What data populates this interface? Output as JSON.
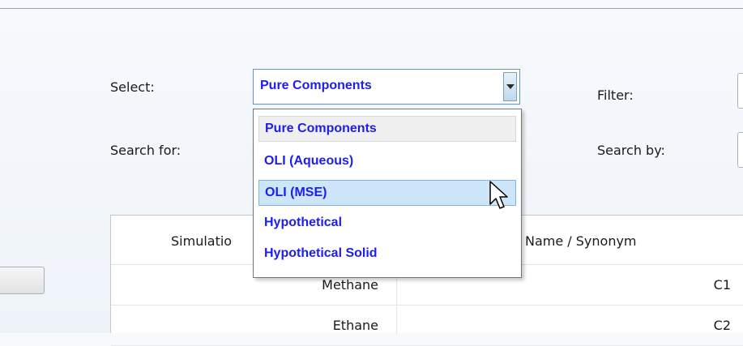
{
  "form": {
    "select_label": "Select:",
    "filter_label": "Filter:",
    "search_for_label": "Search for:",
    "search_by_label": "Search by:"
  },
  "select": {
    "value": "Pure Components",
    "options": [
      {
        "label": "Pure Components",
        "state": "selected"
      },
      {
        "label": "OLI (Aqueous)",
        "state": "normal"
      },
      {
        "label": "OLI (MSE)",
        "state": "hover"
      },
      {
        "label": "Hypothetical",
        "state": "normal"
      },
      {
        "label": "Hypothetical Solid",
        "state": "normal"
      }
    ]
  },
  "table": {
    "columns": [
      "Simulatio",
      "Name / Synonym"
    ],
    "rows": [
      [
        "Methane",
        "C1"
      ],
      [
        "Ethane",
        "C2"
      ]
    ]
  },
  "colors": {
    "option_text": "#1d1df0",
    "hover_bg": "#cde6f7",
    "select_border": "#5b95d6"
  },
  "icons": {
    "dropdown_arrow": "chevron-down-icon",
    "cursor": "mouse-pointer-icon"
  }
}
